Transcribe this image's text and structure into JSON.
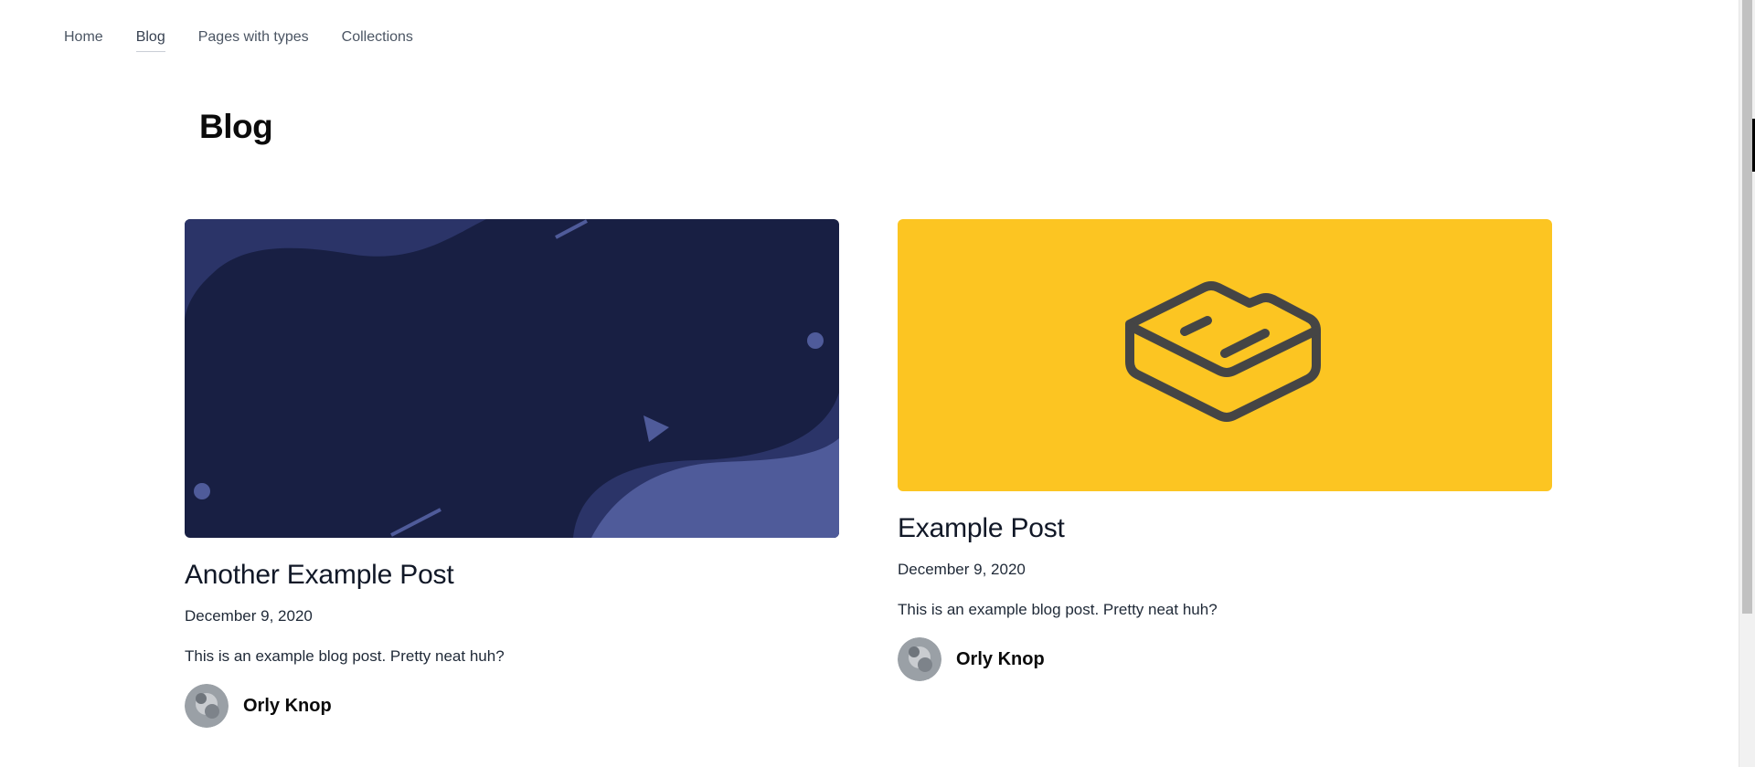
{
  "nav": {
    "items": [
      {
        "label": "Home",
        "active": false
      },
      {
        "label": "Blog",
        "active": true
      },
      {
        "label": "Pages with types",
        "active": false
      },
      {
        "label": "Collections",
        "active": false
      }
    ]
  },
  "page": {
    "title": "Blog"
  },
  "posts": [
    {
      "title": "Another Example Post",
      "date": "December 9, 2020",
      "excerpt": "This is an example blog post. Pretty neat huh?",
      "author": "Orly Knop",
      "cover_icon": "abstract-wave-cover",
      "cover_colors": {
        "background": "#181f43",
        "wave": "#2b3468",
        "accent": "#4f5b9a"
      }
    },
    {
      "title": "Example Post",
      "date": "December 9, 2020",
      "excerpt": "This is an example blog post. Pretty neat huh?",
      "author": "Orly Knop",
      "cover_icon": "box-logo-icon",
      "cover_colors": {
        "background": "#fcc522",
        "icon": "#454545"
      }
    }
  ]
}
